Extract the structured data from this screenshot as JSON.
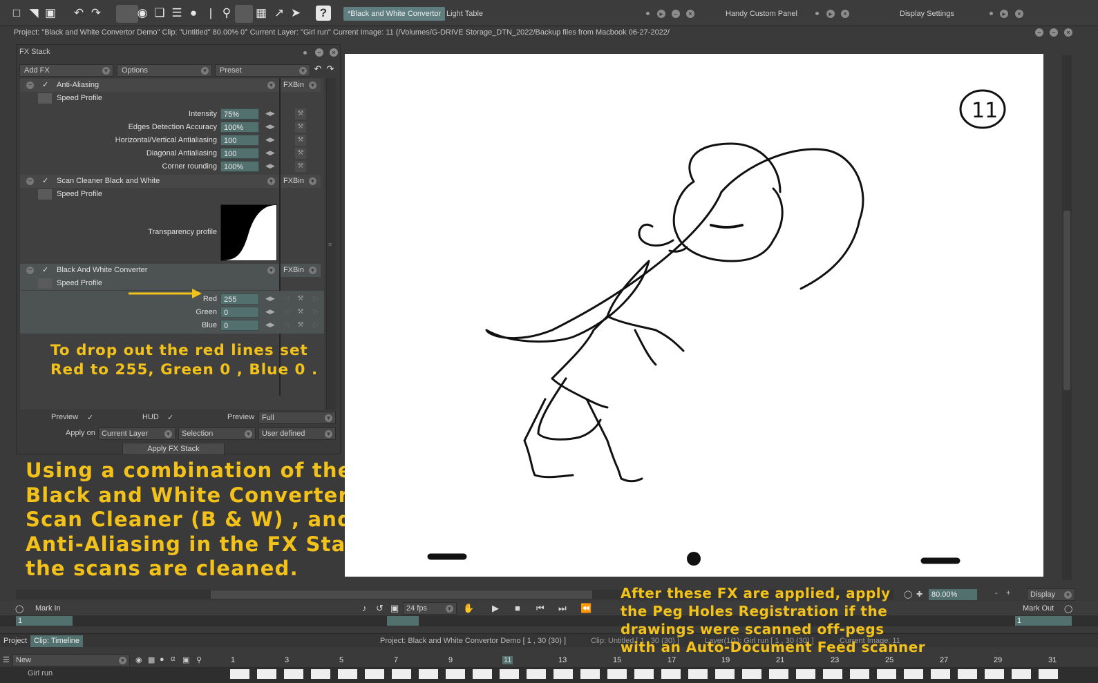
{
  "toolbar": {
    "tabs": [
      "*Black and White Convertor",
      "Light Table"
    ],
    "panels": [
      "Handy Custom Panel",
      "Display Settings"
    ],
    "help_label": "?"
  },
  "infobar": {
    "text": "Project:  \"Black and White Convertor Demo\"  Clip: \"Untitled\"   80.00%   0°  Current Layer: \"Girl run\"  Current Image: 11 (/Volumes/G-DRIVE Storage_DTN_2022/Backup files from Macbook 06-27-2022/"
  },
  "fxstack": {
    "title": "FX Stack",
    "add_fx": "Add FX",
    "options": "Options",
    "preset": "Preset",
    "fxbin": "FXBin",
    "speed_profile": "Speed Profile",
    "anti_aliasing": {
      "label": "Anti-Aliasing",
      "params": [
        {
          "label": "Intensity",
          "value": "75%"
        },
        {
          "label": "Edges Detection Accuracy",
          "value": "100%"
        },
        {
          "label": "Horizontal/Vertical Antialiasing",
          "value": "100"
        },
        {
          "label": "Diagonal Antialiasing",
          "value": "100"
        },
        {
          "label": "Corner rounding",
          "value": "100%"
        }
      ]
    },
    "scan_cleaner": {
      "label": "Scan Cleaner Black and White",
      "transparency_label": "Transparency profile"
    },
    "bw_converter": {
      "label": "Black And White Converter",
      "params": [
        {
          "label": "Red",
          "value": "255"
        },
        {
          "label": "Green",
          "value": "0"
        },
        {
          "label": "Blue",
          "value": "0"
        }
      ]
    },
    "footer": {
      "preview": "Preview",
      "hud": "HUD",
      "preview2": "Preview",
      "preview_mode": "Full",
      "apply_on": "Apply on",
      "current_layer": "Current Layer",
      "selection": "Selection",
      "user_defined": "User defined",
      "apply_button": "Apply FX Stack"
    }
  },
  "notes": {
    "red_lines": [
      "To drop out the red lines set",
      "Red to 255, Green 0 , Blue 0 ."
    ],
    "combination": [
      "Using a combination of the",
      "Black and White Converter,",
      "Scan Cleaner (B & W) , and",
      "Anti-Aliasing in the FX Stack",
      "the scans are cleaned."
    ],
    "peg_holes": [
      "After these FX are applied, apply",
      "the Peg Holes Registration if the",
      "drawings were scanned off-pegs",
      "with an Auto-Document Feed scanner"
    ]
  },
  "viewer": {
    "frame_mark": "11",
    "zoom": "80.00%",
    "display": "Display"
  },
  "transport": {
    "mark_in": "Mark In",
    "mark_out": "Mark Out",
    "fps": "24 fps",
    "in_value": "1",
    "out_value": "1"
  },
  "timeline": {
    "tab_project": "Project",
    "tab_clip": "Clip: Timeline",
    "project_info": "Project: Black and White Convertor Demo [ 1 , 30  (30) ]",
    "clip_info": "Clip: Untitled [ 1 , 30  (30) ]",
    "layer_info": "Layer(1/1): Girl run [ 1 , 30  (30) ]",
    "current_image": "Current Image: 11",
    "new_label": "New",
    "layer_name": "Girl run",
    "frames": [
      "1",
      "3",
      "5",
      "7",
      "9",
      "11",
      "13",
      "15",
      "17",
      "19",
      "21",
      "23",
      "25",
      "27",
      "29",
      "31"
    ]
  },
  "colors": {
    "accent_teal": "#52706e",
    "annotation_yellow": "#f3c21a",
    "arrow_yellow": "#f3c21a"
  }
}
